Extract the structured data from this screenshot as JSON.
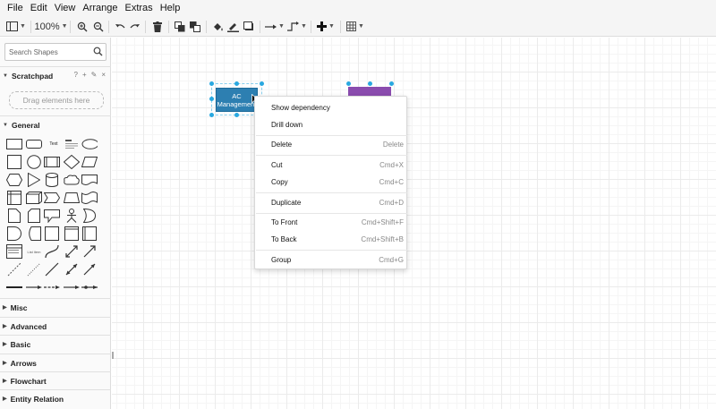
{
  "menubar": [
    "File",
    "Edit",
    "View",
    "Arrange",
    "Extras",
    "Help"
  ],
  "toolbar": {
    "zoom": "100%"
  },
  "sidebar": {
    "search_placeholder": "Search Shapes",
    "scratchpad": {
      "title": "Scratchpad",
      "tools": [
        "?",
        "+",
        "✎",
        "×"
      ],
      "drop_hint": "Drag elements here"
    },
    "general": {
      "title": "General",
      "text_shape": "Text",
      "heading_shape": "Heading",
      "list_shape": "List item"
    },
    "sections": [
      "Misc",
      "Advanced",
      "Basic",
      "Arrows",
      "Flowchart",
      "Entity Relation"
    ]
  },
  "canvas": {
    "node_ac": {
      "line1": "AC",
      "line2": "Management"
    }
  },
  "context_menu": {
    "items": [
      {
        "label": "Show dependency",
        "shortcut": ""
      },
      {
        "label": "Drill down",
        "shortcut": ""
      },
      {
        "label": "Delete",
        "shortcut": "Delete"
      },
      {
        "label": "Cut",
        "shortcut": "Cmd+X"
      },
      {
        "label": "Copy",
        "shortcut": "Cmd+C"
      },
      {
        "label": "Duplicate",
        "shortcut": "Cmd+D"
      },
      {
        "label": "To Front",
        "shortcut": "Cmd+Shift+F"
      },
      {
        "label": "To Back",
        "shortcut": "Cmd+Shift+B"
      },
      {
        "label": "Group",
        "shortcut": "Cmd+G"
      }
    ]
  },
  "colors": {
    "accent": "#29a8e0",
    "node_blue": "#2d7fb1",
    "node_purple": "#8a4cae"
  }
}
